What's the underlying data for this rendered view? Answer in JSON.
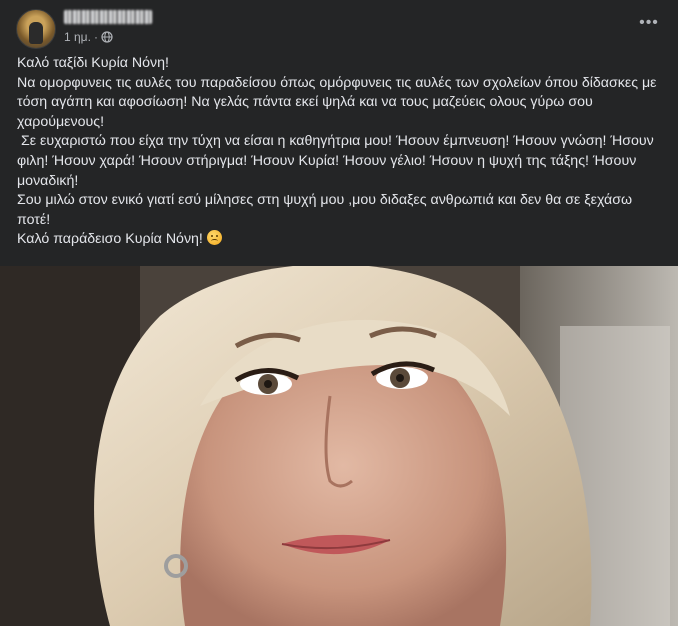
{
  "post": {
    "time": "1 ημ.",
    "separator": "·",
    "more_label": "•••",
    "text": {
      "line1": "Καλό ταξίδι Κυρία Νόνη!",
      "line2": "Να ομορφυνεις τις αυλές του παραδείσου όπως ομόρφυνεις τις αυλές των σχολείων όπου δίδασκες με τόση αγάπη και αφοσίωση! Να γελάς πάντα εκεί ψηλά και να τους μαζεύεις ολους γύρω σου χαρούμενους!",
      "line3": " Σε ευχαριστώ που είχα την τύχη να είσαι η καθηγήτρια μου! Ήσουν έμπνευση! Ήσουν γνώση! Ήσουν φιλη! Ήσουν χαρά! Ήσουν στήριγμα! Ήσουν Κυρία! Ήσουν γέλιο! Ήσουν η ψυχή της τάξης! Ήσουν μοναδική!",
      "line4": "Σου μιλώ στον ενικό γιατί εσύ μίλησες στη ψυχή μου ,μου διδαξες ανθρωπιά και δεν θα σε ξεχάσω ποτέ!",
      "line5": "Καλό παράδεισο Κυρία Νόνη! "
    },
    "emoji": "sad-face-emoji"
  }
}
